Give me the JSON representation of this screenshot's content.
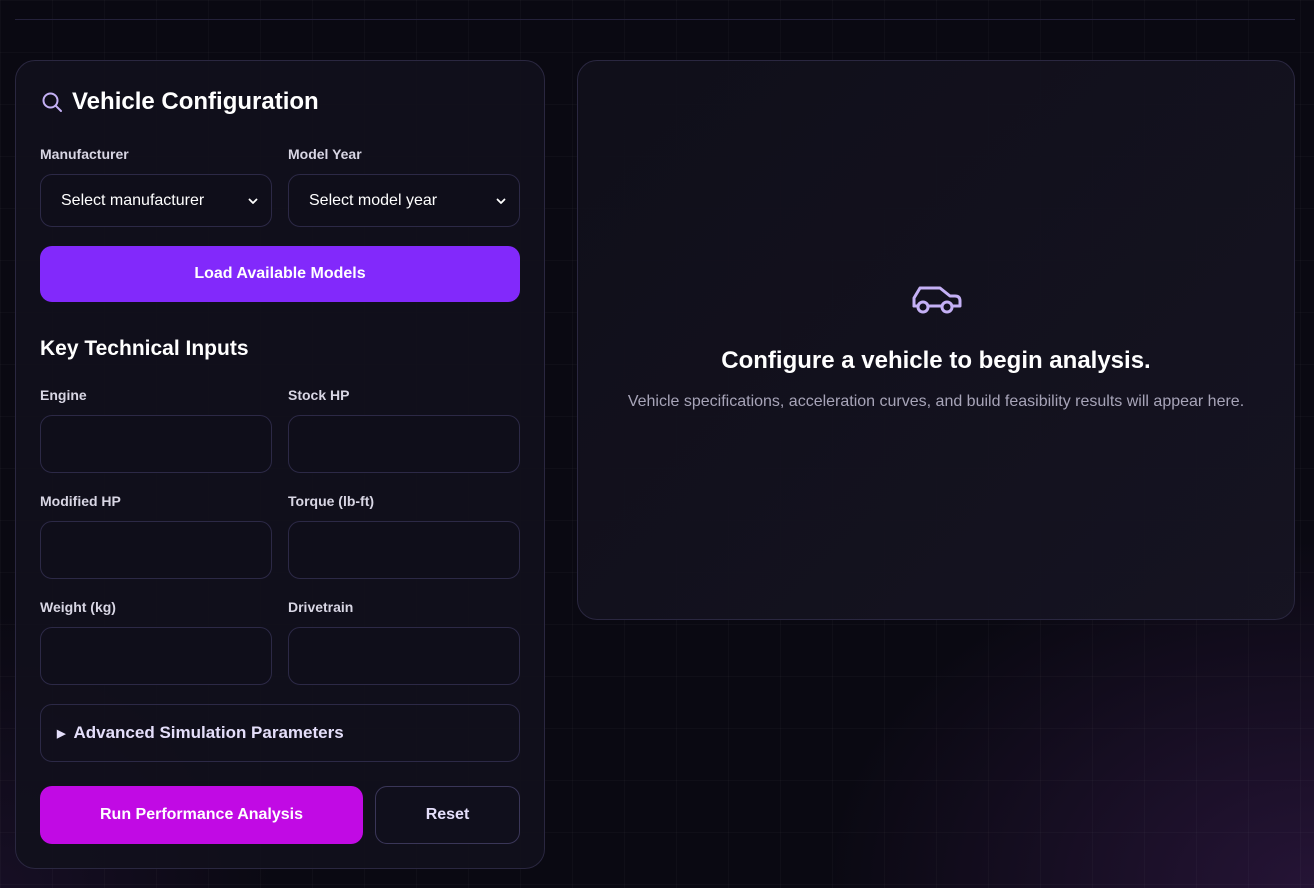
{
  "config": {
    "title": "Vehicle Configuration",
    "manufacturer": {
      "label": "Manufacturer",
      "value": "Select manufacturer"
    },
    "model_year": {
      "label": "Model Year",
      "value": "Select model year"
    },
    "load_button": "Load Available Models",
    "technical": {
      "title": "Key Technical Inputs",
      "fields": {
        "engine": "Engine",
        "stock_hp": "Stock HP",
        "modified_hp": "Modified HP",
        "torque": "Torque (lb-ft)",
        "weight": "Weight (kg)",
        "drivetrain": "Drivetrain"
      }
    },
    "advanced_label": "Advanced Simulation Parameters",
    "run_button": "Run Performance Analysis",
    "reset_button": "Reset"
  },
  "results": {
    "empty_title": "Configure a vehicle to begin analysis.",
    "empty_subtitle": "Vehicle specifications, acceleration curves, and build feasibility results will appear here."
  },
  "icons": {
    "title_icon": "search-icon",
    "empty_icon": "car-icon",
    "select_icon": "chevron-down-icon",
    "advanced_icon": "triangle-right-icon"
  },
  "colors": {
    "accent_purple": "#8229fb",
    "accent_magenta": "#c10ae4",
    "icon_lavender": "#c4b0f5"
  }
}
